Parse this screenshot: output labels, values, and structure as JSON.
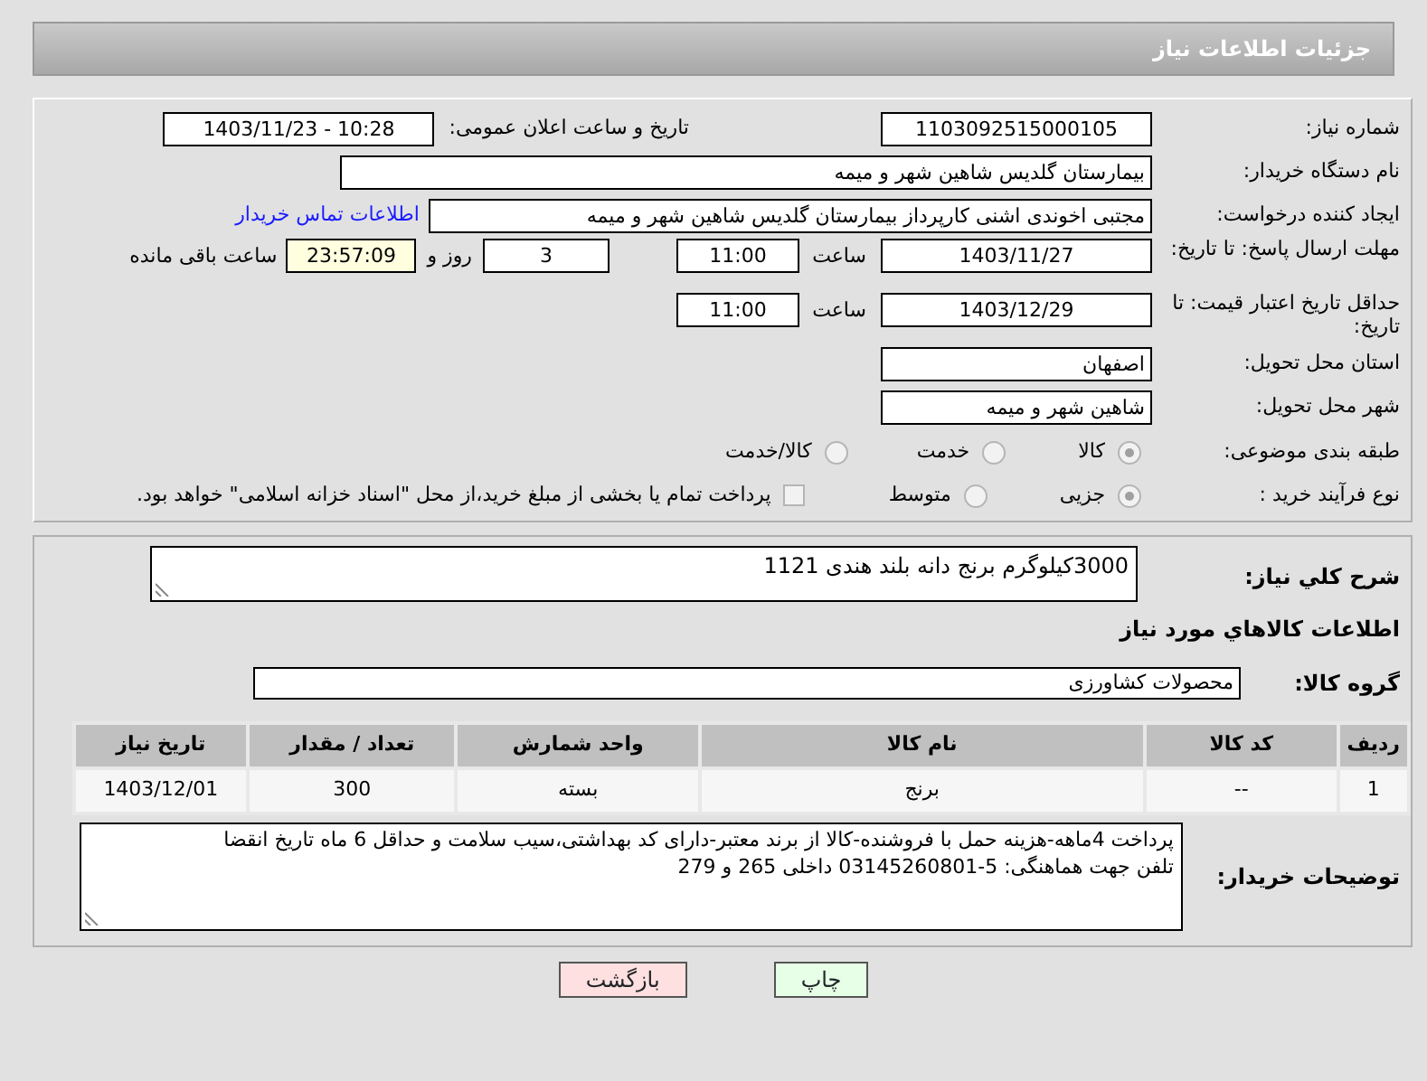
{
  "header": {
    "title": "جزئیات اطلاعات نیاز"
  },
  "details": {
    "need_number": {
      "label": "شماره نیاز:",
      "value": "1103092515000105"
    },
    "announce": {
      "label": "تاریخ و ساعت اعلان عمومی:",
      "value": "1403/11/23 - 10:28"
    },
    "buyer": {
      "label": "نام دستگاه خریدار:",
      "value": "بیمارستان گلدیس  شاهین شهر و میمه"
    },
    "creator": {
      "label": "ایجاد کننده درخواست:",
      "value": "مجتبی اخوندی اشنی کارپرداز بیمارستان گلدیس  شاهین شهر و میمه",
      "link": "اطلاعات تماس خریدار"
    },
    "reply_deadline": {
      "label": "مهلت ارسال پاسخ: تا تاریخ:",
      "date": "1403/11/27",
      "time_label": "ساعت",
      "time": "11:00",
      "days": "3",
      "days_label": "روز و",
      "remaining": "23:57:09",
      "remaining_label": "ساعت باقی مانده"
    },
    "price_validity": {
      "label": "حداقل تاریخ اعتبار قیمت: تا تاریخ:",
      "date": "1403/12/29",
      "time_label": "ساعت",
      "time": "11:00"
    },
    "province": {
      "label": "استان محل تحویل:",
      "value": "اصفهان"
    },
    "city": {
      "label": "شهر محل تحویل:",
      "value": "شاهین شهر و میمه"
    },
    "category": {
      "label": "طبقه بندی موضوعی:",
      "options": [
        {
          "label": "كالا",
          "selected": true
        },
        {
          "label": "خدمت",
          "selected": false
        },
        {
          "label": "كالا/خدمت",
          "selected": false
        }
      ]
    },
    "process": {
      "label": "نوع فرآیند خرید :",
      "options": [
        {
          "label": "جزیی",
          "selected": true
        },
        {
          "label": "متوسط",
          "selected": false
        }
      ],
      "treasury": {
        "label": "پرداخت تمام یا بخشی از مبلغ خرید،از محل \"اسناد خزانه اسلامی\" خواهد بود.",
        "checked": false
      }
    }
  },
  "goods": {
    "summary": {
      "label": "شرح کلي نياز:",
      "value": "3000کیلوگرم برنج دانه بلند هندی 1121"
    },
    "heading": "اطلاعات كالاهاي مورد نياز",
    "group": {
      "label": "گروه کالا:",
      "value": "محصولات کشاورزی"
    },
    "table": {
      "columns": [
        "ردیف",
        "کد کالا",
        "نام کالا",
        "واحد شمارش",
        "تعداد / مقدار",
        "تاریخ نیاز"
      ],
      "rows": [
        [
          "1",
          "--",
          "برنج",
          "بسته",
          "300",
          "1403/12/01"
        ]
      ]
    },
    "buyer_notes": {
      "label": "توضیحات خریدار:",
      "lines": [
        "پرداخت 4ماهه-هزینه حمل با فروشنده-کالا از برند معتبر-دارای کد بهداشتی،سیب سلامت و حداقل 6 ماه تاریخ انقضا",
        "تلفن جهت هماهنگی: 5-03145260801 داخلی 265 و 279"
      ]
    }
  },
  "buttons": [
    {
      "label": "چاپ",
      "kind": "print"
    },
    {
      "label": "بازگشت",
      "kind": "back"
    }
  ]
}
